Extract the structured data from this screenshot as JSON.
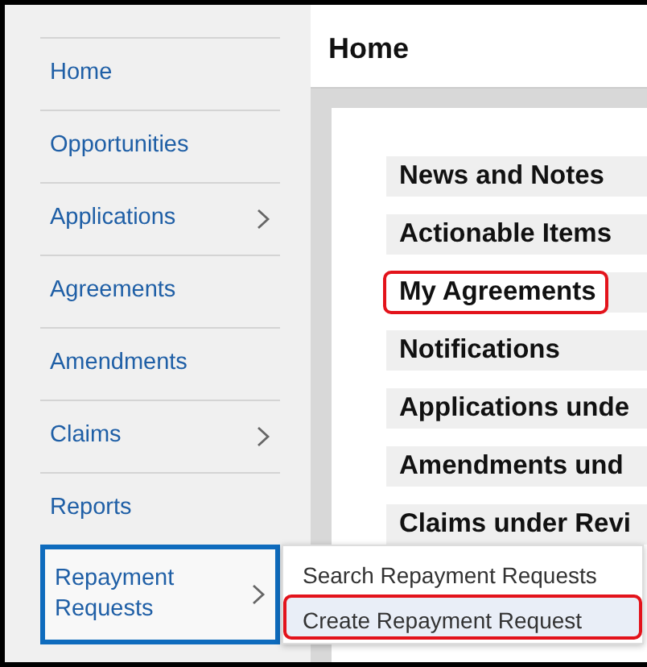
{
  "sidebar": {
    "items": [
      {
        "label": "Home",
        "has_submenu": false,
        "selected": false
      },
      {
        "label": "Opportunities",
        "has_submenu": false,
        "selected": false
      },
      {
        "label": "Applications",
        "has_submenu": true,
        "selected": false
      },
      {
        "label": "Agreements",
        "has_submenu": false,
        "selected": false
      },
      {
        "label": "Amendments",
        "has_submenu": false,
        "selected": false
      },
      {
        "label": "Claims",
        "has_submenu": true,
        "selected": false
      },
      {
        "label": "Reports",
        "has_submenu": false,
        "selected": false
      },
      {
        "label": "Repayment Requests",
        "has_submenu": true,
        "selected": true
      }
    ]
  },
  "page": {
    "title": "Home"
  },
  "sections": [
    {
      "label": "News and Notes",
      "highlighted": false
    },
    {
      "label": "Actionable Items",
      "highlighted": false
    },
    {
      "label": "My Agreements",
      "highlighted": true
    },
    {
      "label": "Notifications",
      "highlighted": false
    },
    {
      "label": "Applications unde",
      "highlighted": false
    },
    {
      "label": "Amendments und",
      "highlighted": false
    },
    {
      "label": "Claims under Revi",
      "highlighted": false
    }
  ],
  "submenu": {
    "items": [
      {
        "label": "Search Repayment Requests",
        "hovered": false,
        "highlighted": false
      },
      {
        "label": "Create Repayment Request",
        "hovered": true,
        "highlighted": true
      }
    ]
  }
}
